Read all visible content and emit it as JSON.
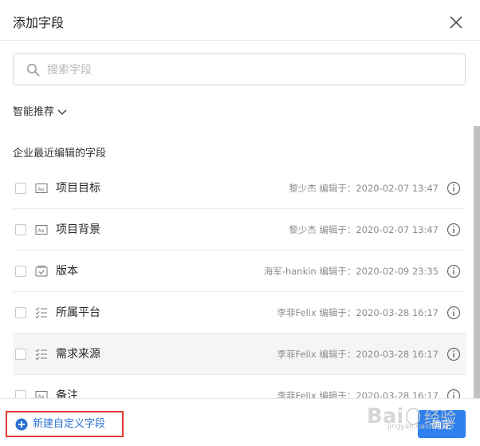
{
  "dialog": {
    "title": "添加字段"
  },
  "search": {
    "placeholder": "搜索字段"
  },
  "recommend": {
    "label": "智能推荐"
  },
  "section": {
    "title": "企业最近编辑的字段"
  },
  "fields": [
    {
      "name": "项目目标",
      "meta": "黎少杰 编辑于：2020-02-07 13:47",
      "icon": "text-field-icon"
    },
    {
      "name": "项目背景",
      "meta": "黎少杰 编辑于：2020-02-07 13:47",
      "icon": "text-field-icon"
    },
    {
      "name": "版本",
      "meta": "海军-hankin 编辑于：2020-02-09 23:35",
      "icon": "version-icon"
    },
    {
      "name": "所属平台",
      "meta": "李菲Felix 编辑于：2020-03-28 16:17",
      "icon": "checklist-icon"
    },
    {
      "name": "需求来源",
      "meta": "李菲Felix 编辑于：2020-03-28 16:17",
      "icon": "checklist-icon"
    },
    {
      "name": "备注",
      "meta": "李菲Felix 编辑于：2020-03-28 16:17",
      "icon": "text-field-icon"
    }
  ],
  "footer": {
    "new_field_label": "新建自定义字段",
    "confirm_label": "确定"
  },
  "watermark": {
    "text": "jingyan.baidu.com"
  },
  "colors": {
    "primary": "#2f80ed",
    "link": "#2a72d4",
    "highlight_border": "#e53935"
  }
}
